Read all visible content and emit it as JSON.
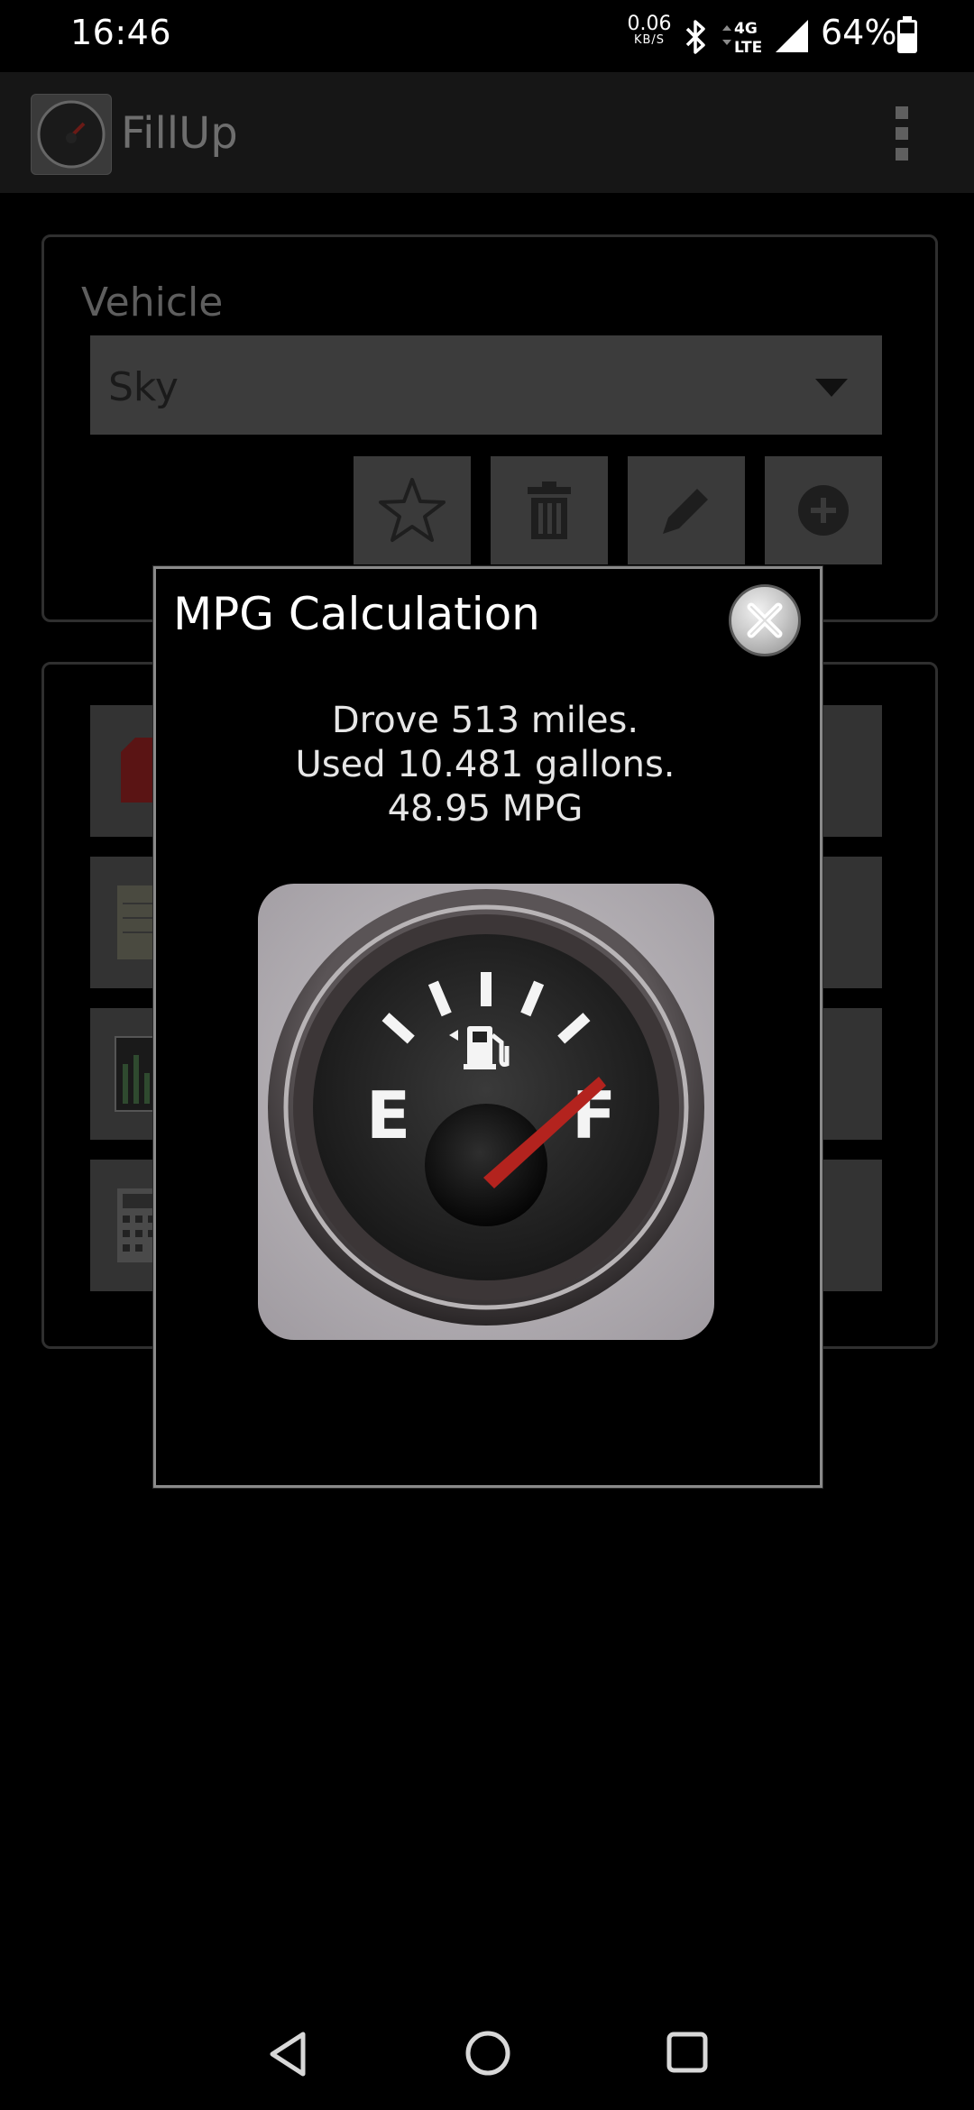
{
  "status_bar": {
    "time": "16:46",
    "net_speed_value": "0.06",
    "net_speed_unit": "KB/S",
    "network_top": "4G",
    "network_bottom": "LTE",
    "battery_percent": "64%"
  },
  "action_bar": {
    "title": "FillUp",
    "icon": "fuel-gauge-icon"
  },
  "vehicle": {
    "label": "Vehicle",
    "selected": "Sky",
    "buttons": [
      "star-icon",
      "trash-icon",
      "pencil-icon",
      "add-icon"
    ]
  },
  "dialog": {
    "title": "MPG Calculation",
    "line_miles": "Drove 513 miles.",
    "line_gallons": "Used 10.481 gallons.",
    "line_mpg": "48.95 MPG",
    "gauge_left_label": "E",
    "gauge_right_label": "F"
  },
  "colors": {
    "background": "#000000",
    "action_bar": "#161616",
    "needle": "#b3231e",
    "dialog_border": "#8a8a8a"
  }
}
